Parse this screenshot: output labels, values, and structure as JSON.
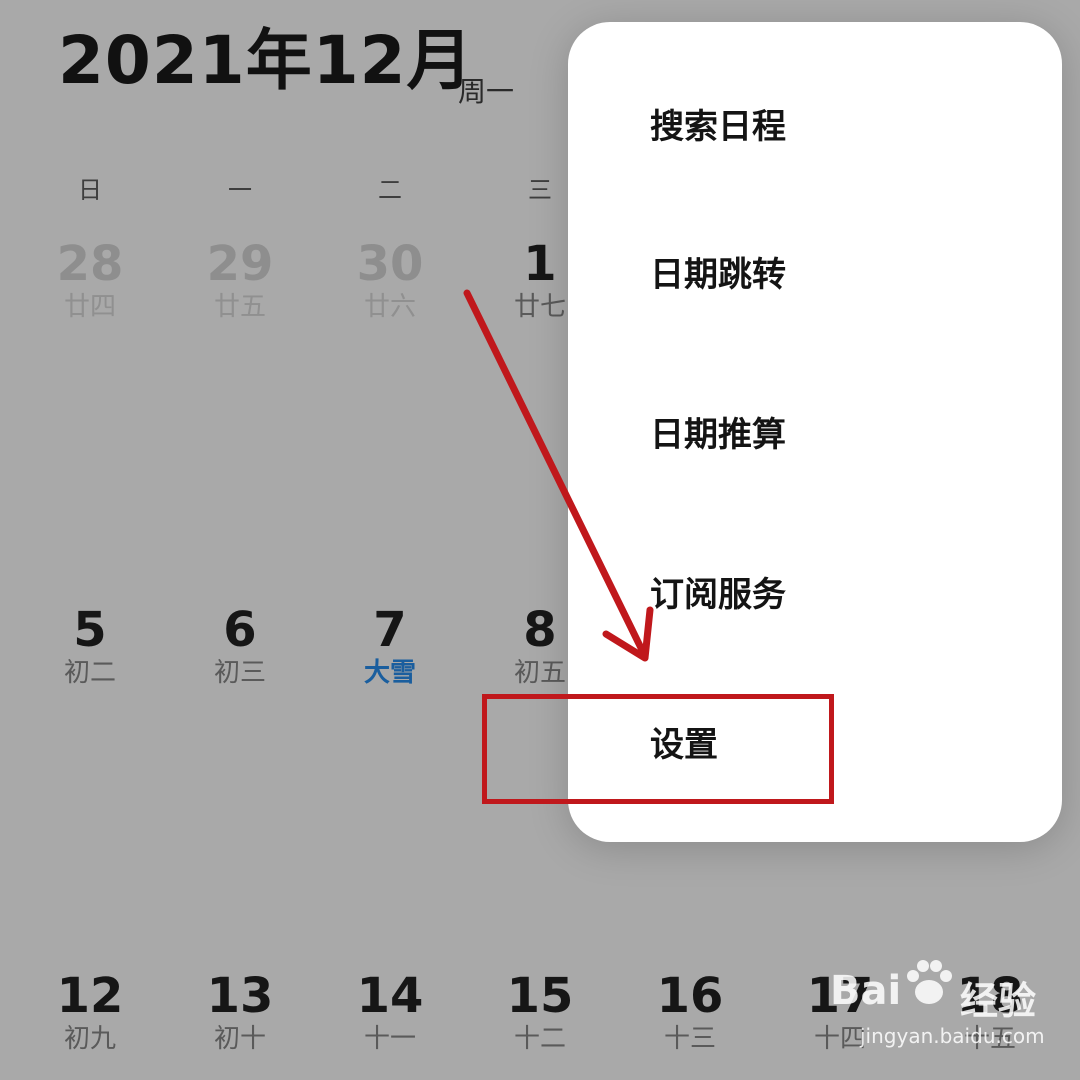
{
  "header": {
    "title": "2021年12月",
    "subtitle": "周一"
  },
  "weekdays": [
    "日",
    "一",
    "二",
    "三"
  ],
  "week1": [
    {
      "num": "28",
      "lunar": "廿四"
    },
    {
      "num": "29",
      "lunar": "廿五"
    },
    {
      "num": "30",
      "lunar": "廿六"
    },
    {
      "num": "1",
      "lunar": "廿七"
    }
  ],
  "week2": [
    {
      "num": "5",
      "lunar": "初二"
    },
    {
      "num": "6",
      "lunar": "初三"
    },
    {
      "num": "7",
      "lunar": "大雪"
    },
    {
      "num": "8",
      "lunar": "初五"
    }
  ],
  "week3": [
    {
      "num": "12",
      "lunar": "初九"
    },
    {
      "num": "13",
      "lunar": "初十"
    },
    {
      "num": "14",
      "lunar": "十一"
    },
    {
      "num": "15",
      "lunar": "十二"
    },
    {
      "num": "16",
      "lunar": "十三"
    },
    {
      "num": "17",
      "lunar": "十四"
    },
    {
      "num": "18",
      "lunar": "十五"
    }
  ],
  "menu": {
    "items": [
      {
        "label": "搜索日程"
      },
      {
        "label": "日期跳转"
      },
      {
        "label": "日期推算"
      },
      {
        "label": "订阅服务"
      },
      {
        "label": "设置"
      }
    ]
  },
  "annotation": {
    "arrow_color": "#c0181c",
    "box_color": "#c0181c"
  },
  "watermark": {
    "brand": "Bai",
    "cn": "经验",
    "url": "jingyan.baidu.com"
  }
}
